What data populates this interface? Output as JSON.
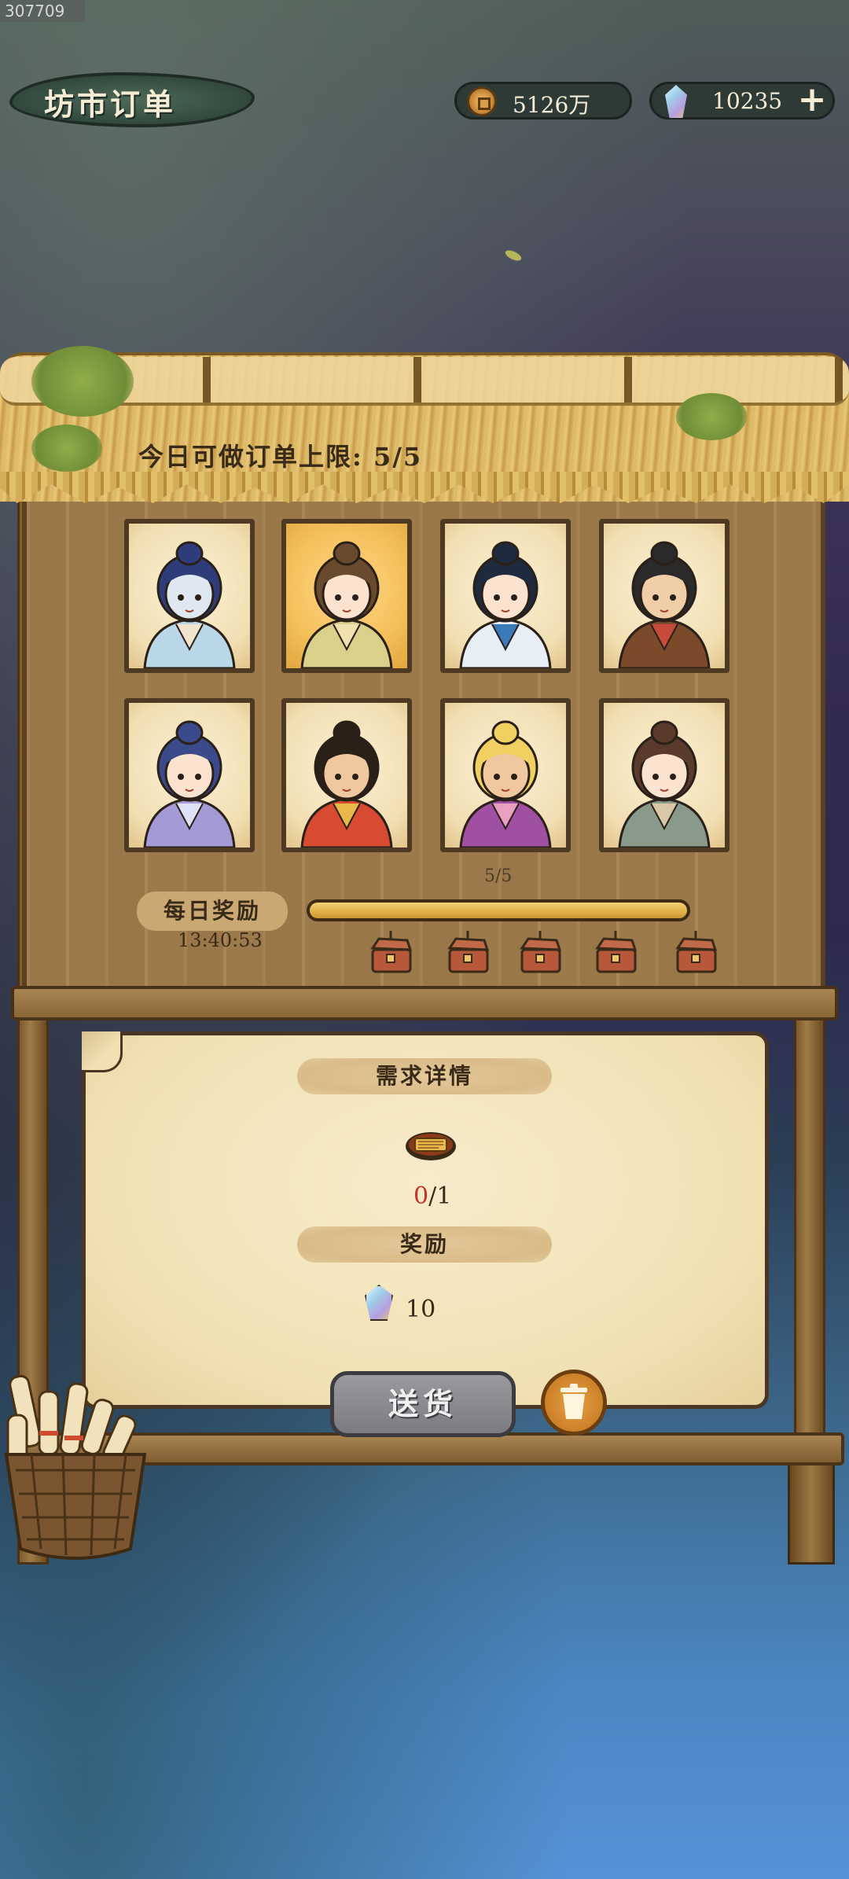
{
  "watermark": "307709",
  "header": {
    "title": "坊市订单",
    "coins": "5126万",
    "gems": "10235",
    "plus_label": "+"
  },
  "orders": {
    "limit_text": "今日可做订单上限: 5/5"
  },
  "characters": [
    {
      "name": "dragon-scholar",
      "selected": false
    },
    {
      "name": "brown-hair-girl",
      "selected": true
    },
    {
      "name": "blue-ribbon-girl",
      "selected": false
    },
    {
      "name": "farmer-boy",
      "selected": false
    },
    {
      "name": "elf-lady",
      "selected": false
    },
    {
      "name": "merchant-abacus",
      "selected": false
    },
    {
      "name": "blonde-dancer",
      "selected": false
    },
    {
      "name": "cat-eared-girl",
      "selected": false
    }
  ],
  "daily_reward": {
    "label": "每日奖励",
    "timer": "13:40:53",
    "progress_text": "5/5",
    "progress": 1.0,
    "chests": 5
  },
  "details": {
    "requirement_header": "需求详情",
    "req_current": "0",
    "req_total": "/1",
    "reward_header": "奖励",
    "reward_amount": "10"
  },
  "actions": {
    "deliver_label": "送货"
  }
}
